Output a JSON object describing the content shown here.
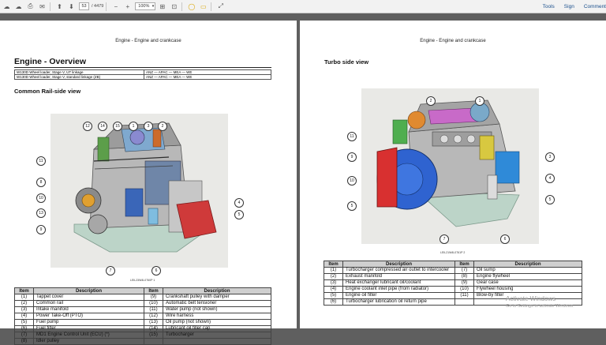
{
  "toolbar": {
    "current_page": "53",
    "total_pages": "/ 4479",
    "zoom": "100%",
    "right_links": [
      "Tools",
      "Sign",
      "Comment"
    ]
  },
  "left_page": {
    "header": "Engine - Engine and crankcase",
    "title": "Engine - Overview",
    "models": [
      [
        "W130D Wheel loader, Stage V, UT linkage",
        "ANZ — APAC — MEA — WE"
      ],
      [
        "W130D Wheel loader, Stage V, standard linkage (ZB)",
        "ANZ — APAC — MEA — WE"
      ]
    ],
    "section": "Common Rail-side view",
    "figure_caption": "LEIL23W4L0760P    1",
    "callouts": [
      "12",
      "14",
      "15",
      "1",
      "3",
      "2",
      "11",
      "8",
      "10",
      "13",
      "9",
      "4",
      "5",
      "7",
      "6"
    ],
    "legend_headers": [
      "Item",
      "Description",
      "Item",
      "Description"
    ],
    "legend_rows": [
      [
        "(1)",
        "Tappet cover",
        "(9)",
        "Crankshaft pulley with damper"
      ],
      [
        "(2)",
        "Common rail",
        "(10)",
        "Automatic belt tensioner"
      ],
      [
        "(3)",
        "Intake manifold",
        "(11)",
        "Water pump (not shown)"
      ],
      [
        "(4)",
        "Power Take-Off (PTO)",
        "(12)",
        "Wire harness"
      ],
      [
        "(5)",
        "Fuel pump",
        "(13)",
        "Oil pump (not shown)"
      ],
      [
        "(6)",
        "Fuel filter",
        "(14)",
        "Lubricant oil filler cap"
      ],
      [
        "(7)",
        "MD1 Engine Control Unit (ECU) (*)",
        "(15)",
        "Turbocharger"
      ],
      [
        "(8)",
        "Idler pulley",
        "",
        ""
      ]
    ]
  },
  "right_page": {
    "header": "Engine - Engine and crankcase",
    "section": "Turbo side view",
    "figure_caption": "LEIL21W4L0761P    2",
    "callouts": [
      "2",
      "1",
      "11",
      "9",
      "10",
      "5",
      "3",
      "4",
      "5",
      "7",
      "6"
    ],
    "legend_headers": [
      "Item",
      "Description",
      "Item",
      "Description"
    ],
    "legend_rows": [
      [
        "(1)",
        "Turbocharger compressed air outlet to intercooler",
        "(7)",
        "Oil sump"
      ],
      [
        "(2)",
        "Exhaust manifold",
        "(8)",
        "Engine flywheel"
      ],
      [
        "(3)",
        "Heat exchanger lubricant oil/coolant",
        "(9)",
        "Gear case"
      ],
      [
        "(4)",
        "Engine coolant inlet pipe (from radiator)",
        "(10)",
        "Flywheel housing"
      ],
      [
        "(5)",
        "Engine oil filter",
        "(11)",
        "Blow-by filter"
      ],
      [
        "(6)",
        "Turbocharger lubrication oil return pipe",
        "",
        ""
      ]
    ]
  },
  "watermark": {
    "line1": "Activate Windows",
    "line2": "Go to Settings to activate Windows."
  }
}
